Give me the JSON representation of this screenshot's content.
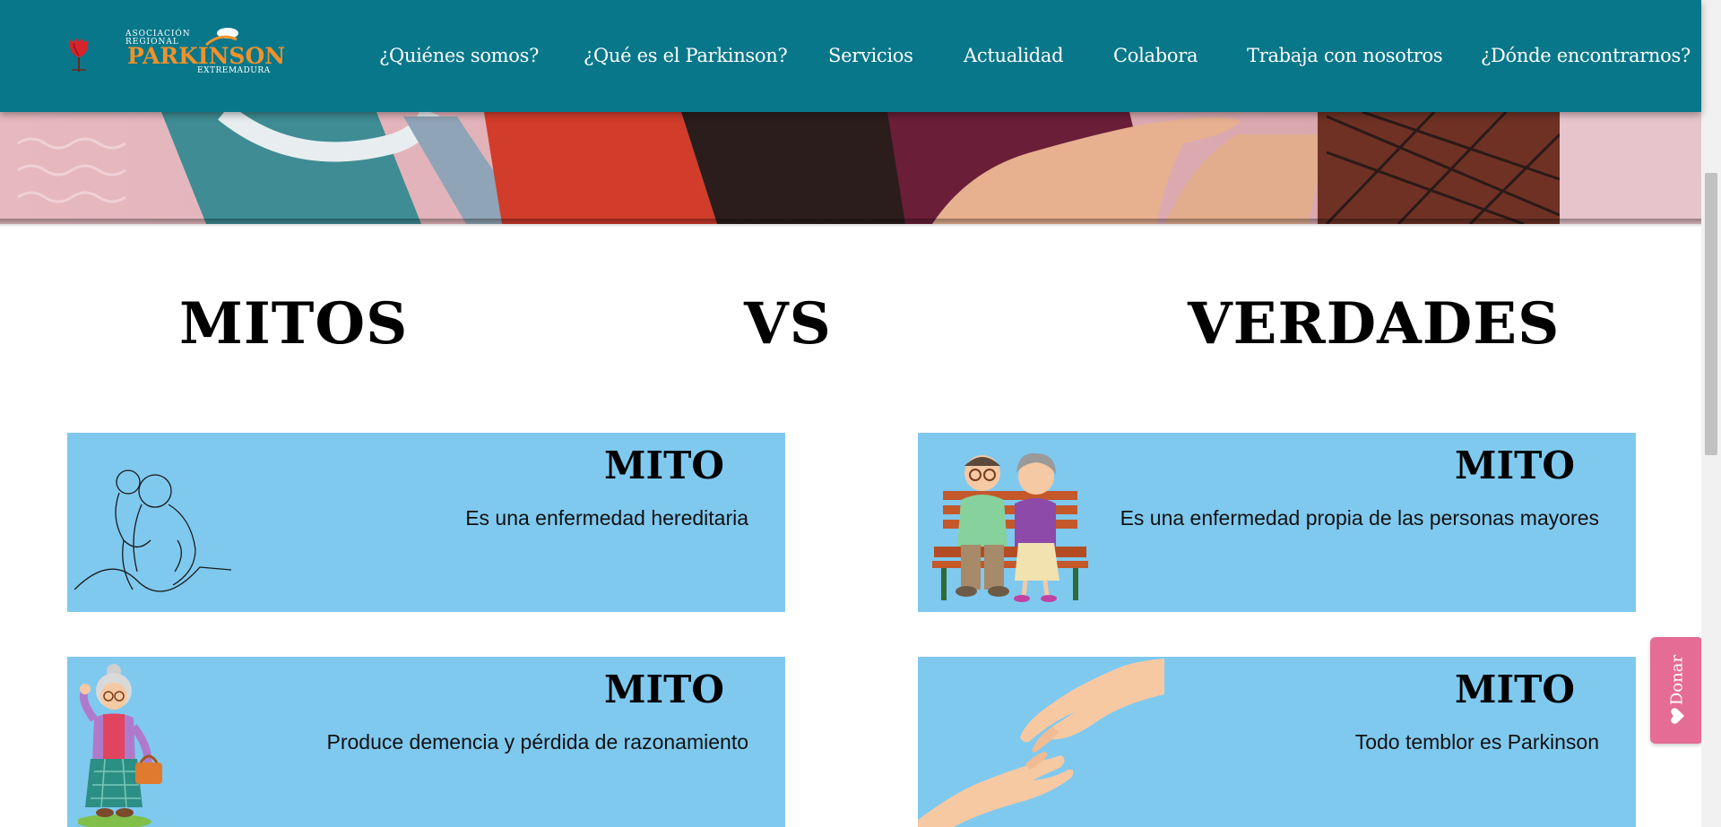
{
  "header": {
    "logo": {
      "line1": "ASOCIACIÓN",
      "line2": "REGIONAL",
      "name": "PARKINSON",
      "region": "EXTREMADURA"
    },
    "nav": [
      {
        "label": "¿Quiénes somos?"
      },
      {
        "label": "¿Qué es el Parkinson?"
      },
      {
        "label": "Servicios"
      },
      {
        "label": "Actualidad"
      },
      {
        "label": "Colabora"
      },
      {
        "label": "Trabaja con nosotros"
      },
      {
        "label": "¿Dónde encontrarnos?"
      }
    ]
  },
  "section": {
    "heading_left": "MITOS",
    "heading_center": "VS",
    "heading_right": "VERDADES"
  },
  "cards": [
    {
      "title": "MITO",
      "text": "Es una enfermedad hereditaria",
      "illustration": "line-drawing-parent-child"
    },
    {
      "title": "MITO",
      "text": "Es una enfermedad propia de las personas mayores",
      "illustration": "elderly-couple-on-bench"
    },
    {
      "title": "MITO",
      "text": "Produce demencia y pérdida de razonamiento",
      "illustration": "elderly-woman-with-handbag"
    },
    {
      "title": "MITO",
      "text": "Todo temblor es Parkinson",
      "illustration": "reaching-hands"
    }
  ],
  "donate": {
    "label": "Donar",
    "icon": "heart-icon"
  },
  "colors": {
    "header": "#08778a",
    "card": "#7fc9ef",
    "logo_orange": "#f0922b",
    "donate": "#e56c95"
  }
}
